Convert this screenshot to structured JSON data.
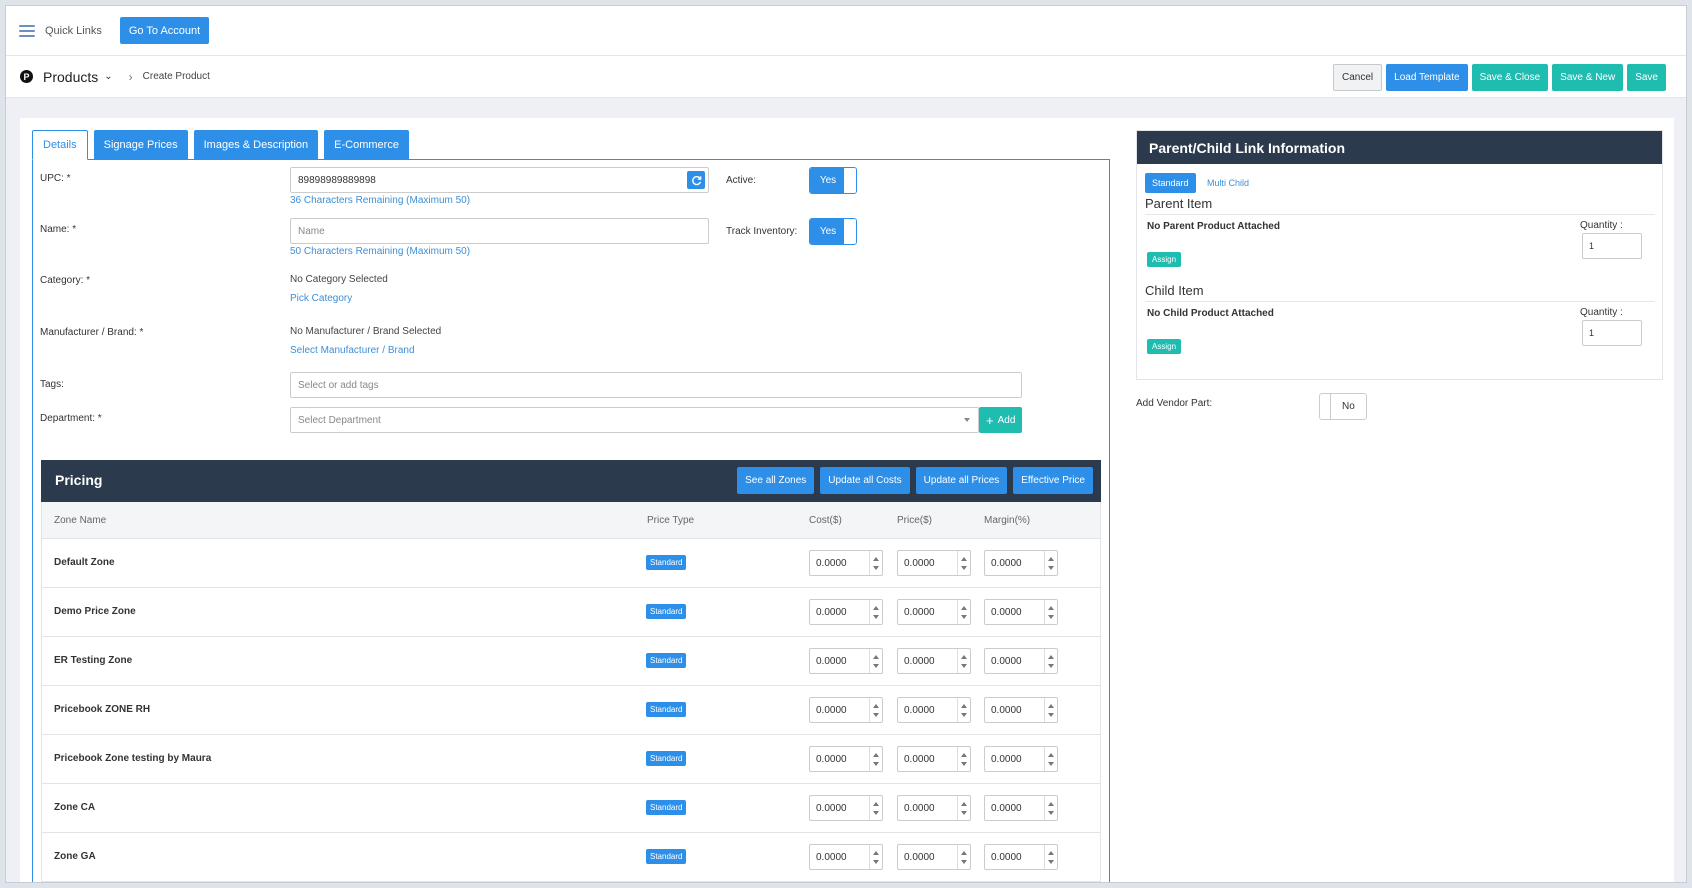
{
  "topbar": {
    "quick_links": "Quick Links",
    "go_to_account": "Go To Account"
  },
  "breadcrumb": {
    "section": "Products",
    "current": "Create Product"
  },
  "actions": {
    "cancel": "Cancel",
    "load_template": "Load Template",
    "save_close": "Save & Close",
    "save_new": "Save & New",
    "save": "Save"
  },
  "tabs": [
    {
      "label": "Details",
      "active": true
    },
    {
      "label": "Signage Prices",
      "active": false
    },
    {
      "label": "Images & Description",
      "active": false
    },
    {
      "label": "E-Commerce",
      "active": false
    }
  ],
  "form": {
    "upc_label": "UPC: *",
    "upc_value": "89898989889898",
    "upc_hint": "36 Characters Remaining (Maximum 50)",
    "name_label": "Name: *",
    "name_placeholder": "Name",
    "name_hint": "50 Characters Remaining (Maximum 50)",
    "active_label": "Active:",
    "active_value": "Yes",
    "track_label": "Track Inventory:",
    "track_value": "Yes",
    "category_label": "Category: *",
    "category_value": "No Category Selected",
    "category_link": "Pick Category",
    "manufacturer_label": "Manufacturer / Brand: *",
    "manufacturer_value": "No Manufacturer / Brand Selected",
    "manufacturer_link": "Select Manufacturer / Brand",
    "tags_label": "Tags:",
    "tags_placeholder": "Select or add tags",
    "department_label": "Department: *",
    "department_placeholder": "Select Department",
    "add_label": "Add"
  },
  "pricing": {
    "title": "Pricing",
    "buttons": {
      "see_all_zones": "See all Zones",
      "update_all_costs": "Update all Costs",
      "update_all_prices": "Update all Prices",
      "effective_price": "Effective Price"
    },
    "columns": {
      "zone": "Zone Name",
      "price_type": "Price Type",
      "cost": "Cost($)",
      "price": "Price($)",
      "margin": "Margin(%)"
    },
    "rows": [
      {
        "zone": "Default Zone",
        "type": "Standard",
        "cost": "0.0000",
        "price": "0.0000",
        "margin": "0.0000"
      },
      {
        "zone": "Demo Price Zone",
        "type": "Standard",
        "cost": "0.0000",
        "price": "0.0000",
        "margin": "0.0000"
      },
      {
        "zone": "ER Testing Zone",
        "type": "Standard",
        "cost": "0.0000",
        "price": "0.0000",
        "margin": "0.0000"
      },
      {
        "zone": "Pricebook ZONE RH",
        "type": "Standard",
        "cost": "0.0000",
        "price": "0.0000",
        "margin": "0.0000"
      },
      {
        "zone": "Pricebook Zone testing by Maura",
        "type": "Standard",
        "cost": "0.0000",
        "price": "0.0000",
        "margin": "0.0000"
      },
      {
        "zone": "Zone CA",
        "type": "Standard",
        "cost": "0.0000",
        "price": "0.0000",
        "margin": "0.0000"
      },
      {
        "zone": "Zone GA",
        "type": "Standard",
        "cost": "0.0000",
        "price": "0.0000",
        "margin": "0.0000"
      }
    ]
  },
  "parent_child": {
    "title": "Parent/Child Link Information",
    "standard": "Standard",
    "multi_child": "Multi Child",
    "parent_title": "Parent Item",
    "parent_status": "No Parent Product Attached",
    "child_title": "Child Item",
    "child_status": "No Child Product Attached",
    "quantity_label": "Quantity :",
    "parent_qty": "1",
    "child_qty": "1",
    "assign": "Assign"
  },
  "vendor": {
    "label": "Add Vendor Part:",
    "value": "No"
  },
  "colors": {
    "primary": "#2e8fe8",
    "teal": "#1fbcb0",
    "dark_header": "#2b3a4d"
  }
}
